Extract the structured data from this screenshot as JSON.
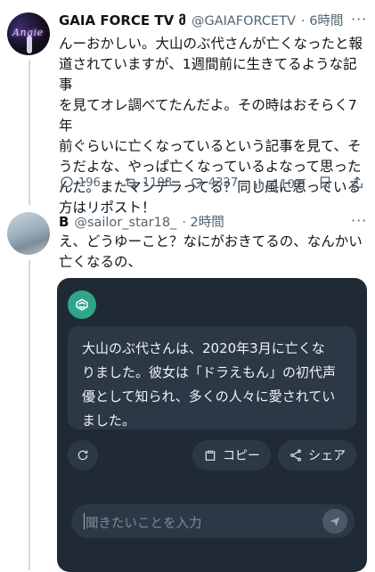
{
  "tweet1": {
    "display_name": "GAIA FORCE TV მ",
    "handle": "@GAIAFORCETV",
    "time": "· 6時間",
    "more": "···",
    "text_lines": [
      "んーおかしい。大山のぶ代さんが亡くなったと報",
      "道されていますが、1週間前に生きてるような記事",
      "を見てオレ調べてたんだよ。その時はおそらく7年",
      "前ぐらいに亡くなっているという記事を見て、そ",
      "うだよな、やっぱ亡くなっているよなって思った",
      "んだ。またマンデラってる？同じ風に思っている",
      "方はリポスト！"
    ],
    "replies": "196",
    "reposts": "1108",
    "likes": "4327",
    "views": "110万",
    "avatar_text": "Angie"
  },
  "tweet2": {
    "display_name": "B",
    "handle": "@sailor_star18_",
    "time": "· 2時間",
    "more": "···",
    "text_lines": [
      "え、どうゆーこと？なにがおきてるの、なんかい",
      "亡くなるの、"
    ]
  },
  "assistant_card": {
    "answer_lines": [
      "大山のぶ代さんは、2020年3月に亡くな",
      "りました。彼女は「ドラえもん」の初代声",
      "優として知られ、多くの人々に愛されてい",
      "ました。"
    ],
    "copy_label": "コピー",
    "share_label": "シェア",
    "input_placeholder": "聞きたいことを入力"
  },
  "colors": {
    "accent_green": "#2fa58a",
    "card_bg": "#1f2a35",
    "bubble_bg": "#2c3845",
    "muted_text": "#536471"
  }
}
